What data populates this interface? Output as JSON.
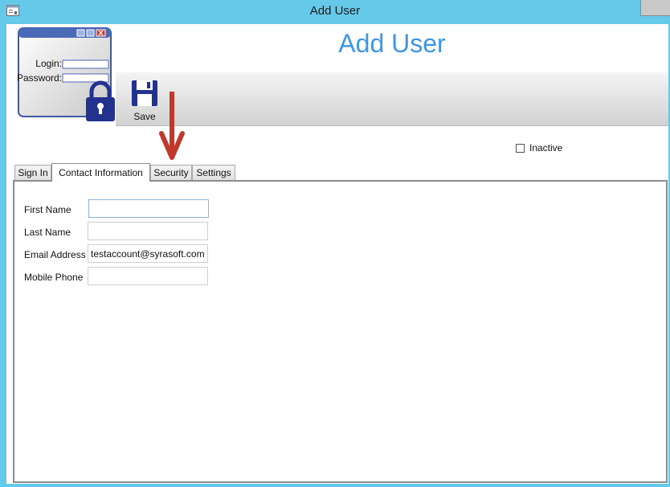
{
  "window": {
    "title": "Add User"
  },
  "badge": {
    "login_label": "Login:",
    "password_label": "Password:"
  },
  "header": {
    "title": "Add User"
  },
  "toolbar": {
    "save_label": "Save"
  },
  "options": {
    "inactive_label": "Inactive",
    "inactive_checked": false
  },
  "tabs": [
    {
      "label": "Sign In"
    },
    {
      "label": "Contact Information",
      "active": true
    },
    {
      "label": "Security"
    },
    {
      "label": "Settings"
    }
  ],
  "form": {
    "first_name": {
      "label": "First Name",
      "value": ""
    },
    "last_name": {
      "label": "Last Name",
      "value": ""
    },
    "email": {
      "label": "Email Address",
      "value": "testaccount@syrasoft.com"
    },
    "mobile": {
      "label": "Mobile Phone",
      "value": ""
    }
  },
  "colors": {
    "titlebar": "#65c9ea",
    "accent_title": "#3d96e6",
    "arrow": "#c0392b",
    "lock": "#23328e"
  }
}
